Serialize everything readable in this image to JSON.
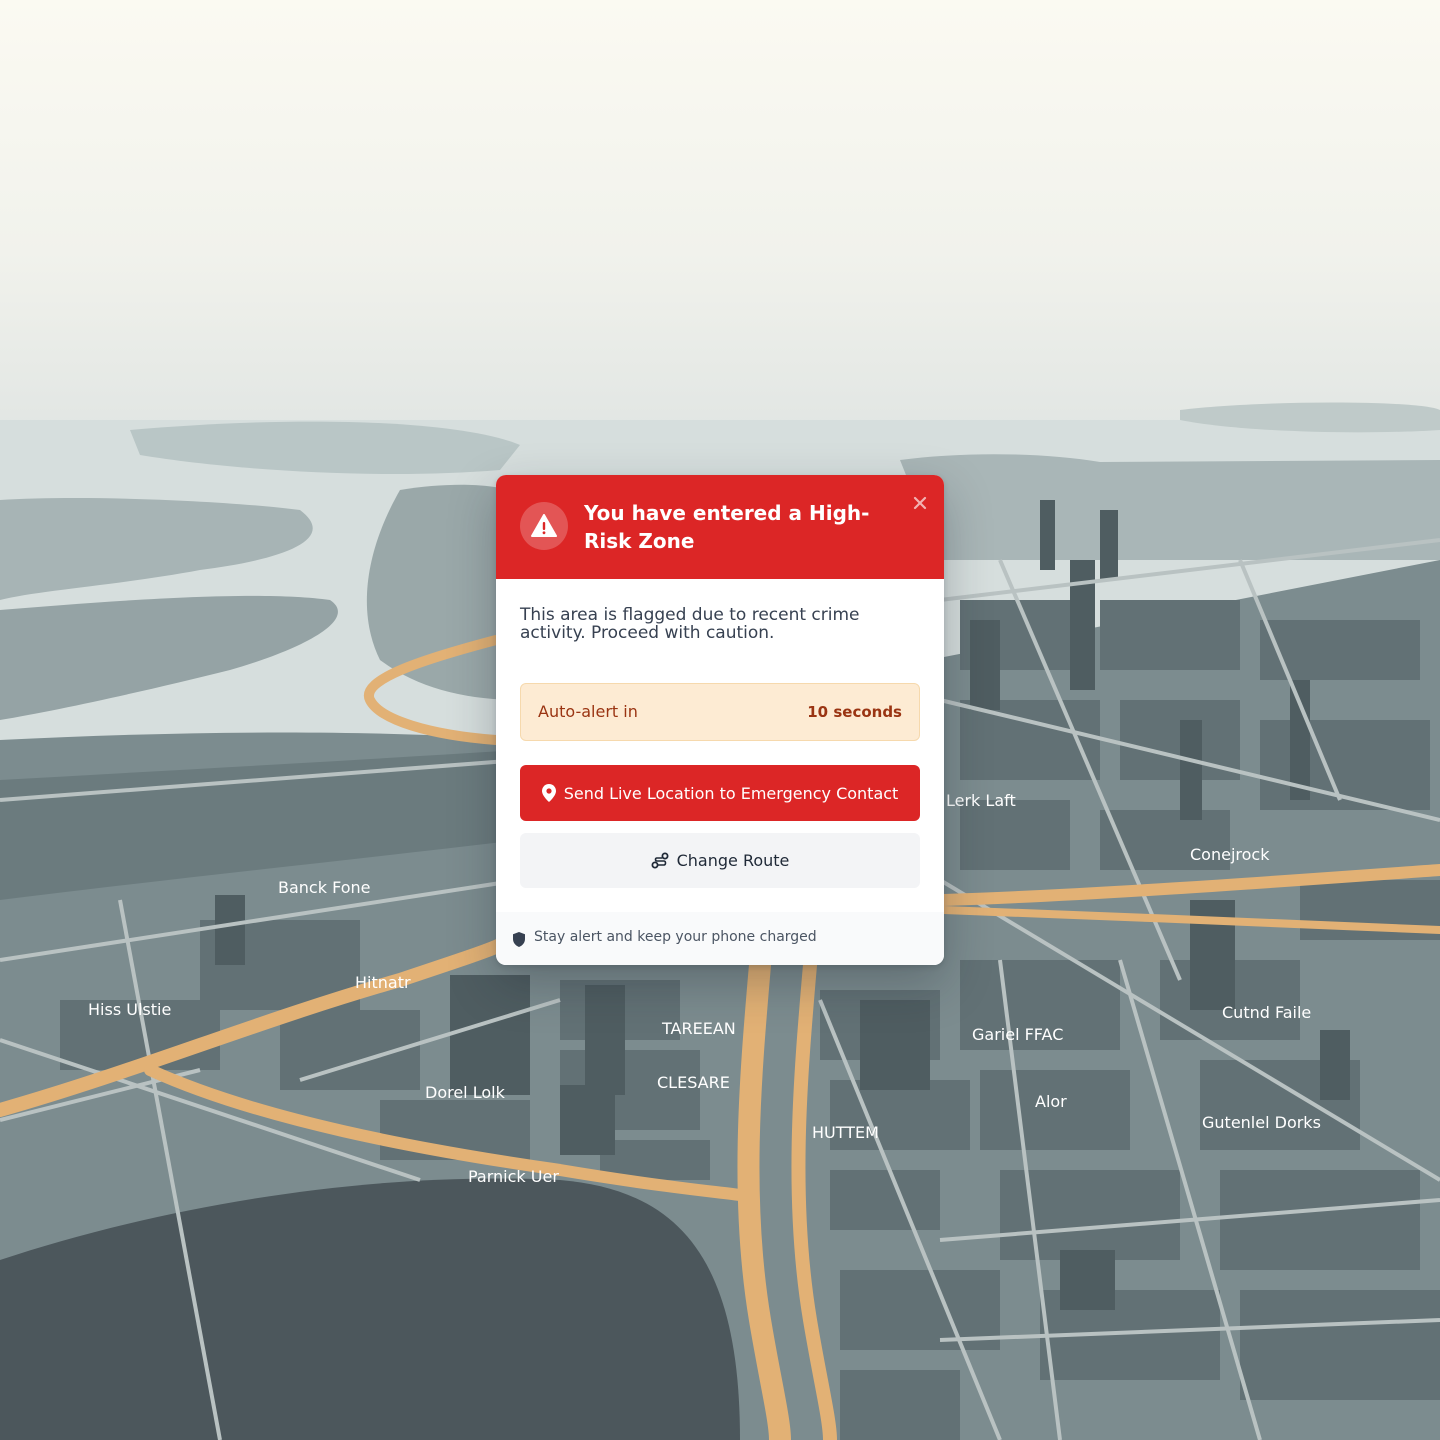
{
  "map": {
    "place_labels": [
      "Banck Fone",
      "Hiss Ulstie",
      "Hitnatr",
      "Dorel Lolk",
      "Parnick Uer",
      "TAREEAN",
      "CLESARE",
      "HUTTEM",
      "Gariel FFAC",
      "Alor",
      "Gutenlel Dorks",
      "Cutnd Faile",
      "Conejrock",
      "Lerk Laft"
    ]
  },
  "alert": {
    "title": "You have entered a High-Risk Zone",
    "message": "This area is flagged due to recent crime activity. Proceed with caution.",
    "countdown_label": "Auto-alert in",
    "countdown_value": "10 seconds",
    "primary_action": "Send Live Location to Emergency Contact",
    "secondary_action": "Change Route",
    "footer_tip": "Stay alert and keep your phone charged",
    "header_color": "#dc2626",
    "icons": {
      "header": "warning-triangle-icon",
      "close": "close-icon",
      "primary": "location-pin-icon",
      "secondary": "route-icon",
      "footer": "shield-icon"
    }
  }
}
